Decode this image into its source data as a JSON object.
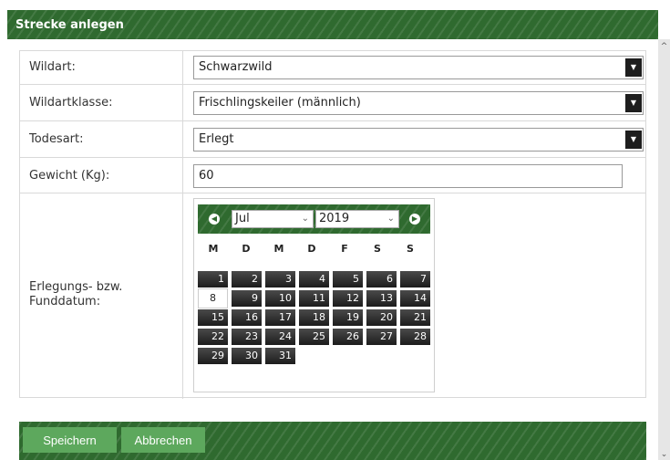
{
  "dialog": {
    "title": "Strecke anlegen"
  },
  "form": {
    "wildart": {
      "label": "Wildart:",
      "value": "Schwarzwild"
    },
    "wildartklasse": {
      "label": "Wildartklasse:",
      "value": "Frischlingskeiler (männlich)"
    },
    "todesart": {
      "label": "Todesart:",
      "value": "Erlegt"
    },
    "gewicht": {
      "label": "Gewicht (Kg):",
      "value": "60"
    },
    "datum": {
      "label": "Erlegungs- bzw. Funddatum:"
    }
  },
  "calendar": {
    "month": "Jul",
    "year": "2019",
    "weekdays": [
      "M",
      "D",
      "M",
      "D",
      "F",
      "S",
      "S"
    ],
    "days": [
      "1",
      "2",
      "3",
      "4",
      "5",
      "6",
      "7",
      "8",
      "9",
      "10",
      "11",
      "12",
      "13",
      "14",
      "15",
      "16",
      "17",
      "18",
      "19",
      "20",
      "21",
      "22",
      "23",
      "24",
      "25",
      "26",
      "27",
      "28",
      "29",
      "30",
      "31"
    ],
    "selected_day": "8"
  },
  "footer": {
    "save_label": "Speichern",
    "cancel_label": "Abbrechen"
  }
}
